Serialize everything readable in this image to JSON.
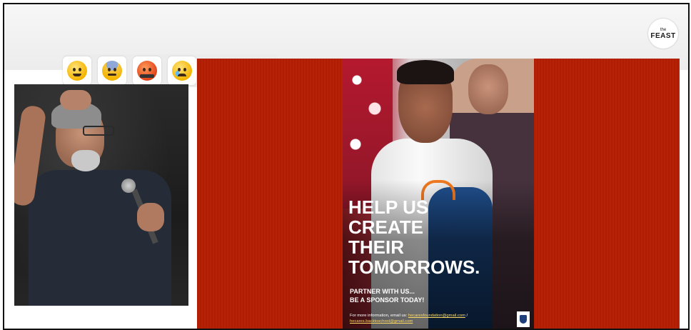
{
  "header": {
    "logo": {
      "small": "the",
      "big": "FEAST"
    }
  },
  "reactions": [
    {
      "icon": "face-with-tongue-icon"
    },
    {
      "icon": "fearful-face-icon"
    },
    {
      "icon": "angry-face-icon"
    },
    {
      "icon": "crying-face-icon"
    }
  ],
  "speaker_video": {
    "description_icon": "speaker-video"
  },
  "poster": {
    "headline": [
      "HELP US",
      "CREATE",
      "THEIR",
      "TOMORROWS."
    ],
    "subline": [
      "PARTNER WITH US...",
      "BE A SPONSOR TODAY!"
    ],
    "info_label": "For more information, email us:",
    "email1": "hecaresfoundation@gmail.com",
    "separator": " /",
    "email2": "hecares.backtoschool@gmail.com"
  },
  "colors": {
    "panel": "#b51e03",
    "headline": "#ffffff",
    "link": "#ffd966"
  }
}
